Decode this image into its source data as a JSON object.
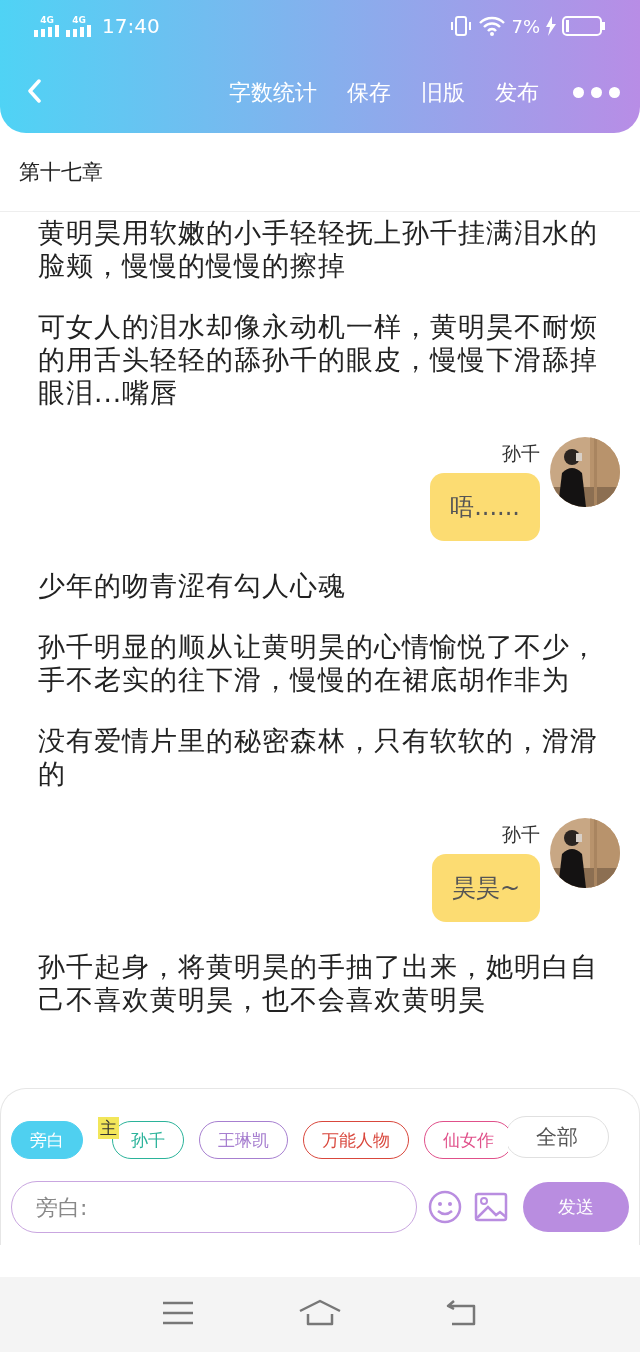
{
  "status_bar": {
    "network_1": "4G",
    "network_2": "4G",
    "time": "17:40",
    "battery": "7%"
  },
  "toolbar": {
    "actions": [
      "字数统计",
      "保存",
      "旧版",
      "发布"
    ]
  },
  "chapter_title": "第十七章",
  "messages": [
    {
      "kind": "narration",
      "text": "黄明昊用软嫩的小手轻轻抚上孙千挂满泪水的脸颊，慢慢的慢慢的擦掉"
    },
    {
      "kind": "narration",
      "text": "可女人的泪水却像永动机一样，黄明昊不耐烦的用舌头轻轻的舔孙千的眼皮，慢慢下滑舔掉眼泪...嘴唇"
    },
    {
      "kind": "dialogue",
      "speaker": "孙千",
      "text": "唔......"
    },
    {
      "kind": "narration",
      "text": "少年的吻青涩有勾人心魂"
    },
    {
      "kind": "narration",
      "text": "孙千明显的顺从让黄明昊的心情愉悦了不少，手不老实的往下滑，慢慢的在裙底胡作非为"
    },
    {
      "kind": "narration",
      "text": "没有爱情片里的秘密森林，只有软软的，滑滑的"
    },
    {
      "kind": "dialogue",
      "speaker": "孙千",
      "text": "昊昊~"
    },
    {
      "kind": "narration",
      "text": "孙千起身，将黄明昊的手抽了出来，她明白自己不喜欢黄明昊，也不会喜欢黄明昊"
    }
  ],
  "characters": [
    {
      "name": "旁白",
      "selected": true,
      "color": "#4fd0f0"
    },
    {
      "name": "孙千",
      "selected": false,
      "color": "#2bb39a",
      "badge": "主"
    },
    {
      "name": "王琳凯",
      "selected": false,
      "color": "#a77fd0"
    },
    {
      "name": "万能人物",
      "selected": false,
      "color": "#d9473c"
    },
    {
      "name": "仙女作",
      "selected": false,
      "color": "#e0508a"
    }
  ],
  "all_button": "全部",
  "composer": {
    "placeholder": "旁白:",
    "send": "发送"
  }
}
